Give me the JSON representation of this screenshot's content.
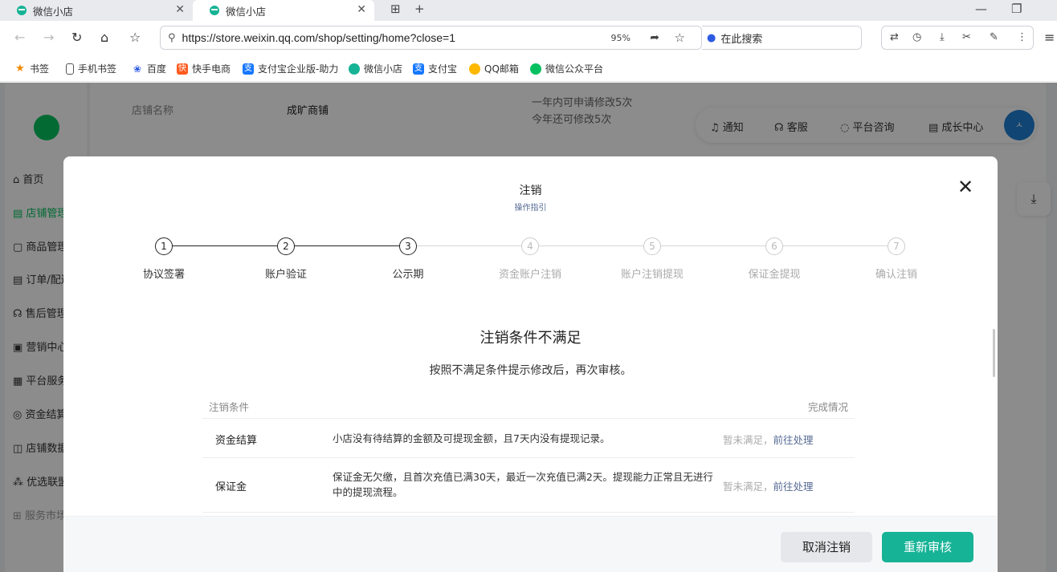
{
  "browser": {
    "tabs": [
      {
        "title": "微信小店"
      },
      {
        "title": "微信小店"
      }
    ],
    "url": "https://store.weixin.qq.com/shop/setting/home?close=1",
    "zoom": "95%",
    "search_placeholder": "在此搜索",
    "bookmarks": [
      {
        "label": "书签"
      },
      {
        "label": "手机书签"
      },
      {
        "label": "百度"
      },
      {
        "label": "快手电商"
      },
      {
        "label": "支付宝企业版-助力"
      },
      {
        "label": "微信小店"
      },
      {
        "label": "支付宝"
      },
      {
        "label": "QQ邮箱"
      },
      {
        "label": "微信公众平台"
      }
    ]
  },
  "sidebar": {
    "items": [
      {
        "label": "首页"
      },
      {
        "label": "店铺管理"
      },
      {
        "label": "商品管理"
      },
      {
        "label": "订单/配送"
      },
      {
        "label": "售后管理"
      },
      {
        "label": "营销中心"
      },
      {
        "label": "平台服务"
      },
      {
        "label": "资金结算"
      },
      {
        "label": "店铺数据"
      },
      {
        "label": "优选联盟"
      },
      {
        "label": "服务市场"
      }
    ]
  },
  "background": {
    "shop_name_label": "店铺名称",
    "shop_name_value": "成旷商铺",
    "limit_line1": "一年内可申请修改5次",
    "limit_line2": "今年还可修改5次",
    "topbar": {
      "notify": "通知",
      "service": "客服",
      "consult": "平台咨询",
      "growth": "成长中心"
    }
  },
  "modal": {
    "title": "注销",
    "guide_link": "操作指引",
    "steps": [
      {
        "num": "1",
        "label": "协议签署",
        "done": true
      },
      {
        "num": "2",
        "label": "账户验证",
        "done": true
      },
      {
        "num": "3",
        "label": "公示期",
        "done": true
      },
      {
        "num": "4",
        "label": "资金账户注销",
        "done": false
      },
      {
        "num": "5",
        "label": "账户注销提现",
        "done": false
      },
      {
        "num": "6",
        "label": "保证金提现",
        "done": false
      },
      {
        "num": "7",
        "label": "确认注销",
        "done": false
      }
    ],
    "headline": "注销条件不满足",
    "subline": "按照不满足条件提示修改后，再次审核。",
    "table": {
      "col_condition": "注销条件",
      "col_status": "完成情况",
      "rows": [
        {
          "name": "资金结算",
          "desc": "小店没有待结算的金额及可提现金额，且7天内没有提现记录。",
          "status": "暂未满足，",
          "action": "前往处理"
        },
        {
          "name": "保证金",
          "desc": "保证金无欠缴，且首次充值已满30天，最近一次充值已满2天。提现能力正常且无进行中的提现流程。",
          "status": "暂未满足，",
          "action": "前往处理"
        }
      ]
    },
    "cancel_button": "取消注销",
    "retry_button": "重新审核"
  }
}
